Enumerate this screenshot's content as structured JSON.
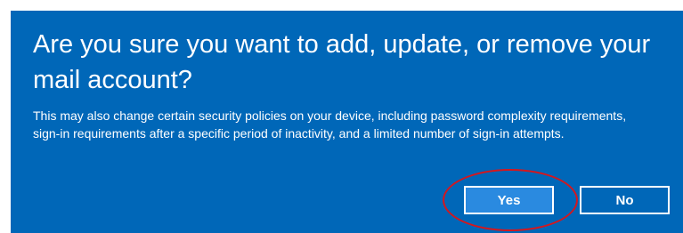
{
  "dialog": {
    "title": "Are you sure you want to add, update, or remove your mail account?",
    "message": "This may also change certain security policies on your device, including password complexity requirements, sign-in requirements after a specific period of inactivity, and a limited number of sign-in attempts.",
    "yes_label": "Yes",
    "no_label": "No"
  },
  "colors": {
    "dialog_background": "#0067b8",
    "primary_button": "#2a8ae0",
    "highlight_ring": "#d4171e",
    "text": "#ffffff"
  }
}
